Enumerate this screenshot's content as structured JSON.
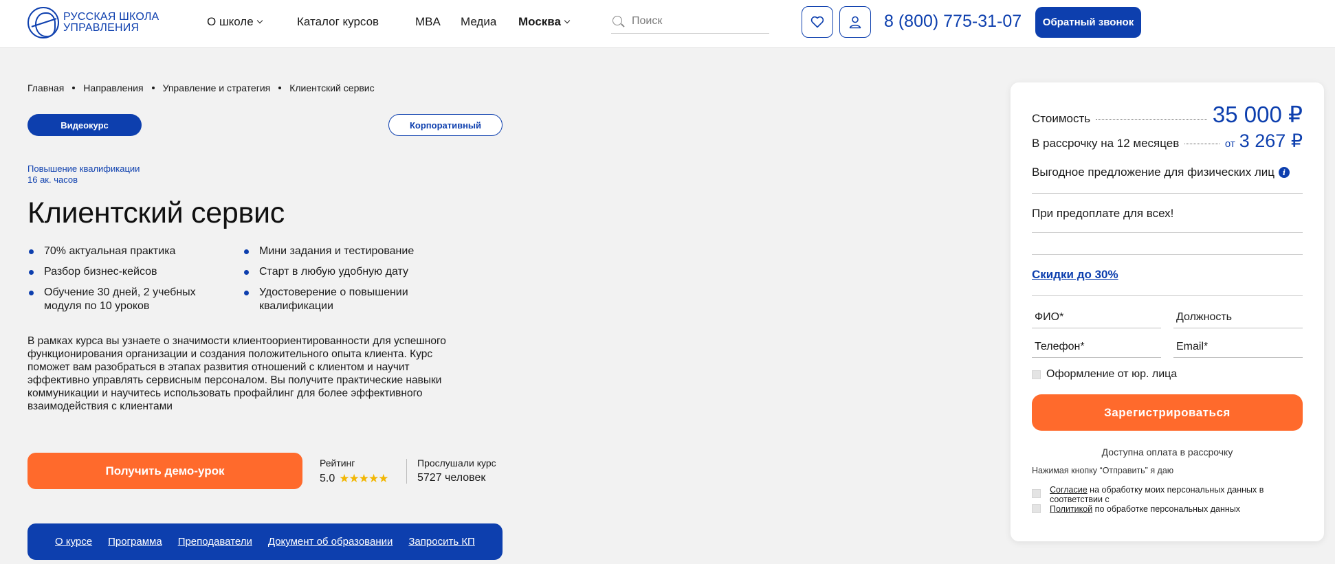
{
  "header": {
    "logo_line1": "РУССКАЯ ШКОЛА",
    "logo_line2": "УПРАВЛЕНИЯ",
    "nav": {
      "about": "О школе",
      "catalog": "Каталог курсов",
      "mba": "MBA",
      "media": "Медиа",
      "city": "Москва"
    },
    "search_placeholder": "Поиск",
    "phone": "8 (800) 775-31-07",
    "callback_label": "Обратный звонок"
  },
  "breadcrumb": [
    "Главная",
    "Направления",
    "Управление и стратегия",
    "Клиентский сервис"
  ],
  "tags": {
    "video": "Видеокурс",
    "corporate": "Корпоративный"
  },
  "course": {
    "type": "Повышение квалификации",
    "hours": "16 ак. часов",
    "title": "Клиентский сервис",
    "features_left": [
      "70% актуальная практика",
      "Разбор бизнес-кейсов",
      "Обучение 30 дней, 2 учебных модуля по 10 уроков"
    ],
    "features_right": [
      "Мини задания и тестирование",
      "Старт в любую удобную дату",
      "Удостоверение о повышении квалификации"
    ],
    "description": "В рамках курса вы узнаете о значимости клиентоориентированности для успешного функционирования организации и создания положительного опыта клиента. Курс поможет вам разобраться в этапах развития отношений с клиентом и научит эффективно управлять сервисным персоналом. Вы получите практические навыки коммуникации и научитесь использовать профайлинг для более эффективного взаимодействия с клиентами",
    "demo_label": "Получить демо-урок",
    "rating_label": "Рейтинг",
    "rating_value": "5.0",
    "rating_stars": 5,
    "listened_label": "Прослушали курс",
    "listened_value": "5727 человек"
  },
  "bottom_nav": [
    "О курсе",
    "Программа",
    "Преподаватели",
    "Документ об образовании",
    "Запросить КП"
  ],
  "panel": {
    "cost_label": "Стоимость",
    "cost_value": "35 000 ₽",
    "installment_label": "В рассрочку на 12 месяцев",
    "installment_from": "от",
    "installment_value": "3 267 ₽",
    "offer_text": "Выгодное предложение для физических лиц",
    "prepay_text": "При предоплате для всех!",
    "discount_link": "Скидки до 30%",
    "fields": {
      "name": "ФИО*",
      "position": "Должность",
      "phone": "Телефон*",
      "email": "Email*"
    },
    "legal_entity_label": "Оформление от юр. лица",
    "register_label": "Зарегистрироваться",
    "installment_note": "Доступна оплата в рассрочку",
    "agree_note": "Нажимая кнопку “Отправить” я даю",
    "consent1_link": "Согласие",
    "consent1_text": " на обработку моих персональных данных в соответствии с",
    "consent2_link": "Политикой",
    "consent2_text": " по обработке персональных данных"
  },
  "colors": {
    "brand": "#0d3fae",
    "accent": "#ff6a2c",
    "background": "#f2f2f2"
  }
}
